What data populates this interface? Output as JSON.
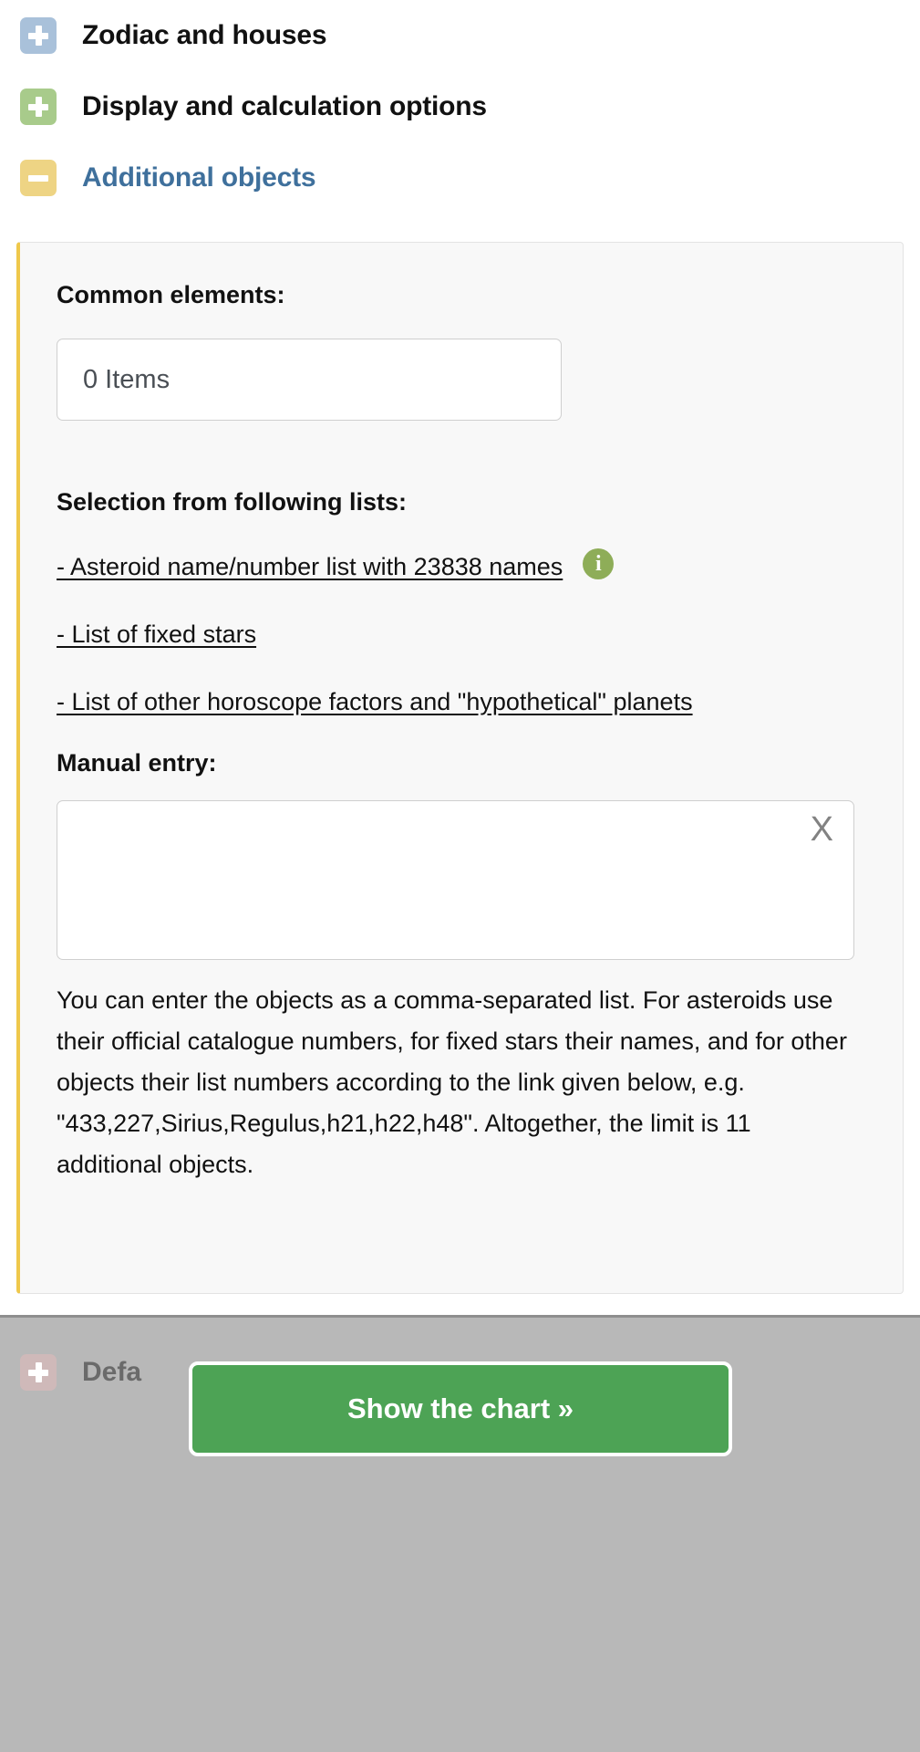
{
  "sections": [
    {
      "label": "Zodiac and houses",
      "state": "collapsed",
      "icon": "plus-icon",
      "color": "#a9c1da"
    },
    {
      "label": "Display and calculation options",
      "state": "collapsed",
      "icon": "plus-icon",
      "color": "#a8cb8b"
    },
    {
      "label": "Additional objects",
      "state": "expanded",
      "icon": "minus-icon",
      "color": "#eed484"
    }
  ],
  "panel": {
    "accent_color": "#efc84b",
    "common_elements_label": "Common elements:",
    "items_select_value": "0 Items",
    "selection_label": "Selection from following lists:",
    "links": [
      {
        "text": "- Asteroid name/number list with 23838 names",
        "info_icon": "info-icon",
        "info_color": "#8ead58"
      },
      {
        "text": "- List of fixed stars"
      },
      {
        "text": "- List of other horoscope factors and \"hypothetical\" planets"
      }
    ],
    "manual_entry_label": "Manual entry:",
    "manual_entry_value": "",
    "manual_entry_placeholder": "",
    "clear_label": "X",
    "help_text": "You can enter the objects as a comma-separated list. For asteroids use their official catalogue numbers, for fixed stars their names, and for other objects their list numbers according to the link given below, e.g. \"433,227,Sirius,Regulus,h21,h22,h48\". Altogether, the limit is 11 additional objects."
  },
  "bottom": {
    "section_label": "Defa",
    "section_icon": "plus-icon",
    "section_icon_color": "#cfb9b9",
    "submit_label": "Show the chart »",
    "submit_color": "#4da355"
  }
}
